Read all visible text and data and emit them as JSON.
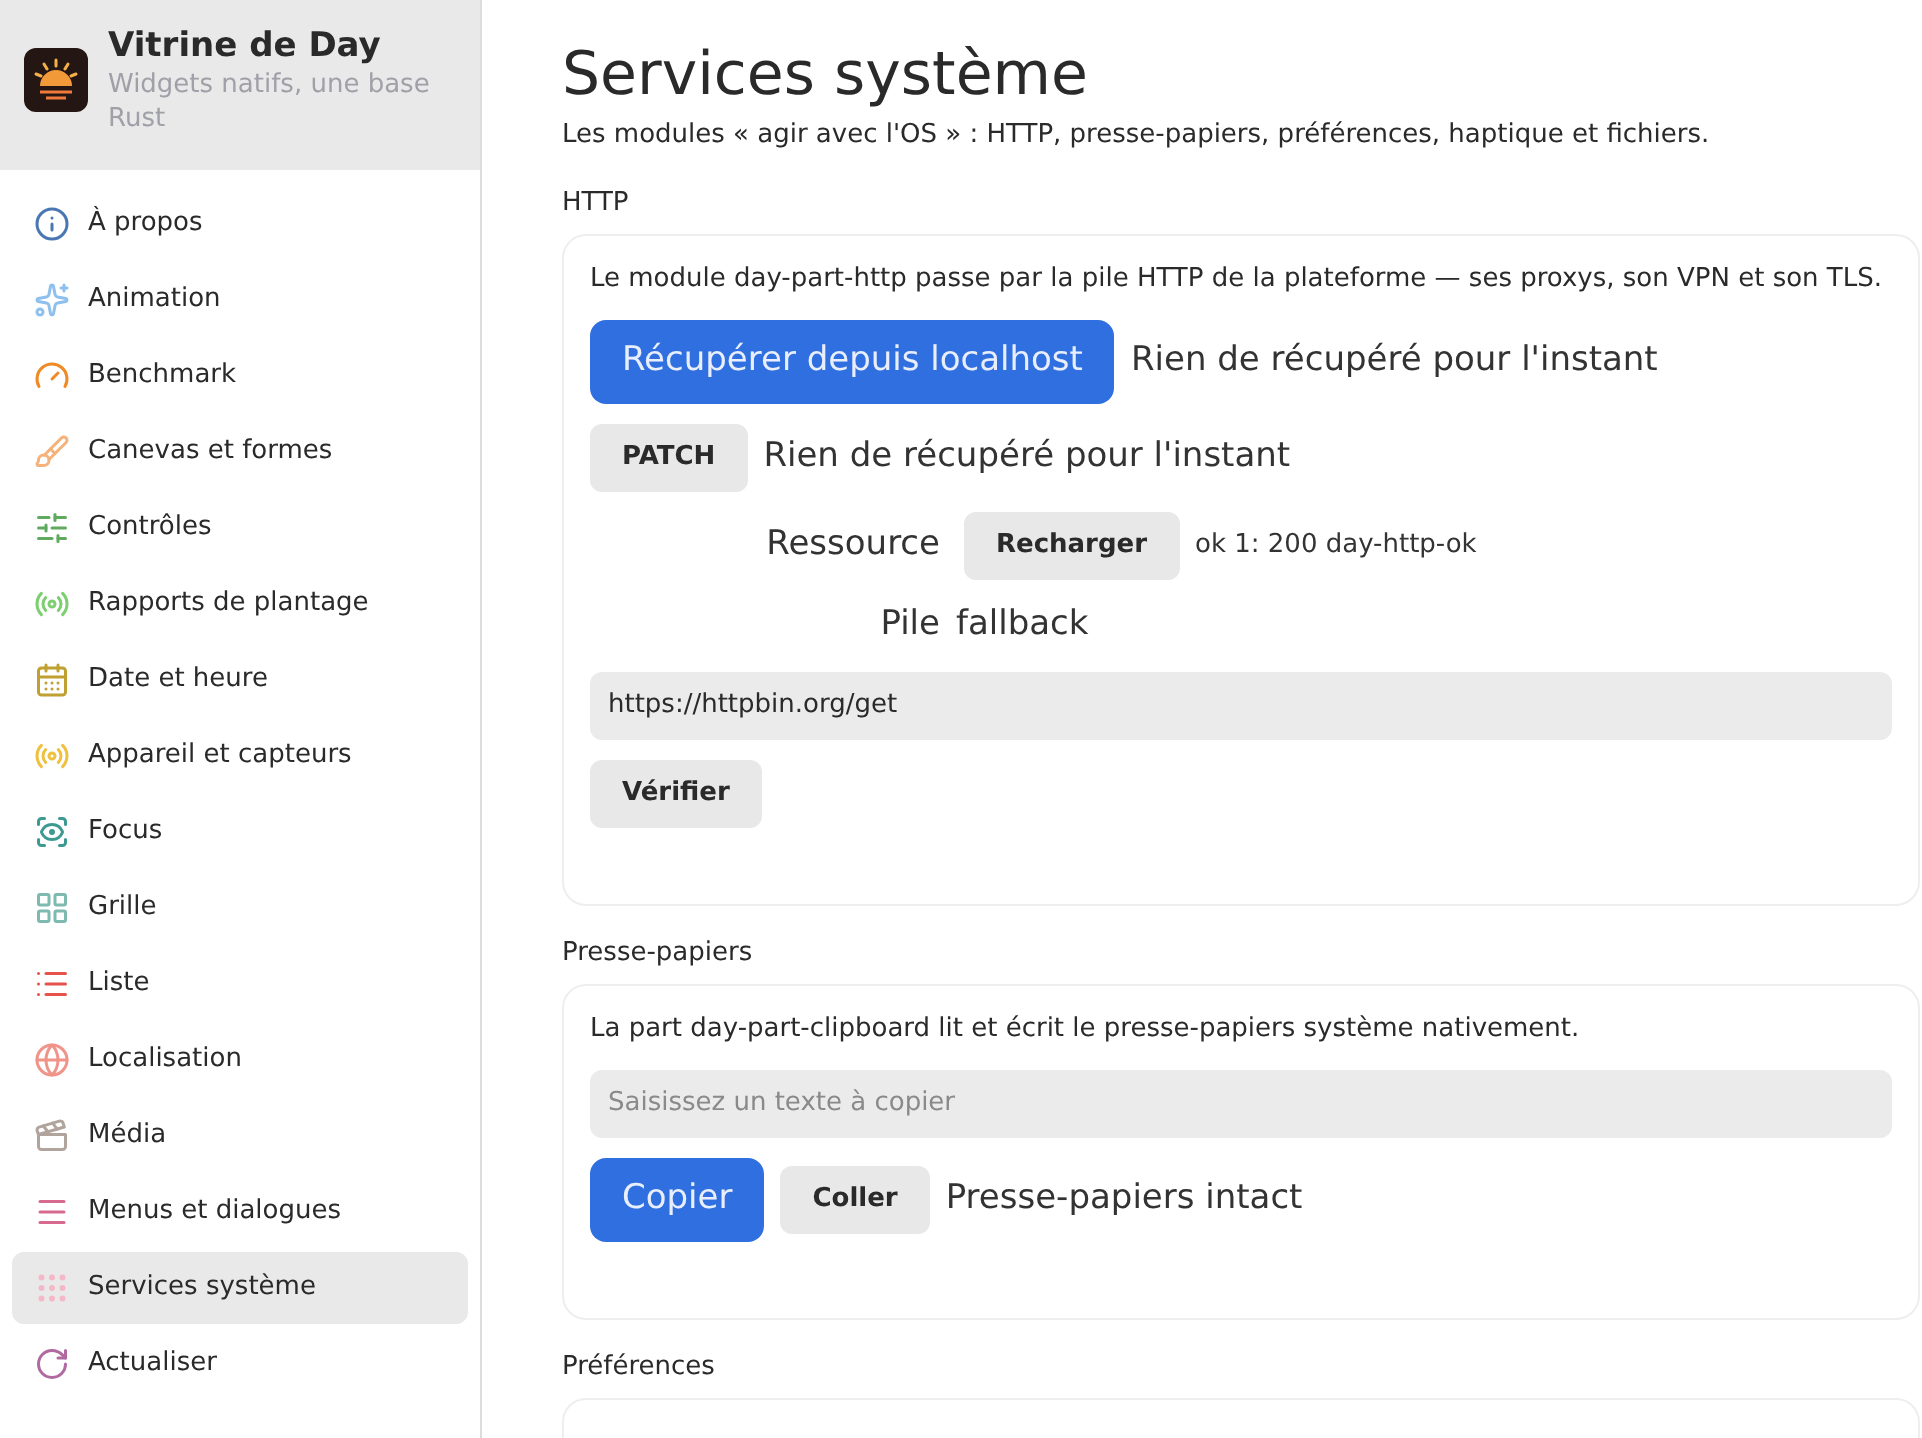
{
  "sidebar": {
    "title": "Vitrine de Day",
    "subtitle": "Widgets natifs, une base Rust",
    "items": [
      {
        "label": "À propos",
        "selected": false
      },
      {
        "label": "Animation",
        "selected": false
      },
      {
        "label": "Benchmark",
        "selected": false
      },
      {
        "label": "Canevas et formes",
        "selected": false
      },
      {
        "label": "Contrôles",
        "selected": false
      },
      {
        "label": "Rapports de plantage",
        "selected": false
      },
      {
        "label": "Date et heure",
        "selected": false
      },
      {
        "label": "Appareil et capteurs",
        "selected": false
      },
      {
        "label": "Focus",
        "selected": false
      },
      {
        "label": "Grille",
        "selected": false
      },
      {
        "label": "Liste",
        "selected": false
      },
      {
        "label": "Localisation",
        "selected": false
      },
      {
        "label": "Média",
        "selected": false
      },
      {
        "label": "Menus et dialogues",
        "selected": false
      },
      {
        "label": "Services système",
        "selected": true
      },
      {
        "label": "Actualiser",
        "selected": false
      }
    ]
  },
  "page": {
    "title": "Services système",
    "subtitle": "Les modules « agir avec l'OS » : HTTP, presse-papiers, préférences, haptique et fichiers.",
    "sections": [
      {
        "heading": "HTTP",
        "rows": [
          {
            "kind": "text",
            "text": "Le module day-part-http passe par la pile HTTP de la plateforme — ses proxys, son VPN et son TLS."
          },
          {
            "kind": "action",
            "buttons": [
              {
                "label": "Récupérer depuis localhost",
                "primary": true
              }
            ],
            "status": "Rien de récupéré pour l'instant"
          },
          {
            "kind": "action",
            "buttons": [
              {
                "label": "PATCH",
                "primary": false
              }
            ],
            "status": "Rien de récupéré pour l'instant"
          },
          {
            "kind": "labeled",
            "label": "Ressource",
            "button": "Recharger",
            "note": "ok 1: 200 day-http-ok"
          },
          {
            "kind": "labeled",
            "label": "Pile",
            "value": "fallback"
          },
          {
            "kind": "field",
            "value": "https://httpbin.org/get"
          },
          {
            "kind": "action",
            "buttons": [
              {
                "label": "Vérifier",
                "primary": false
              }
            ]
          }
        ]
      },
      {
        "heading": "Presse-papiers",
        "rows": [
          {
            "kind": "text",
            "text": "La part day-part-clipboard lit et écrit le presse-papiers système nativement."
          },
          {
            "kind": "field",
            "placeholder": "Saisissez un texte à copier"
          },
          {
            "kind": "action",
            "buttons": [
              {
                "label": "Copier",
                "primary": true
              },
              {
                "label": "Coller",
                "primary": false
              }
            ],
            "status": "Presse-papiers intact"
          }
        ]
      },
      {
        "heading": "Préférences"
      }
    ]
  }
}
